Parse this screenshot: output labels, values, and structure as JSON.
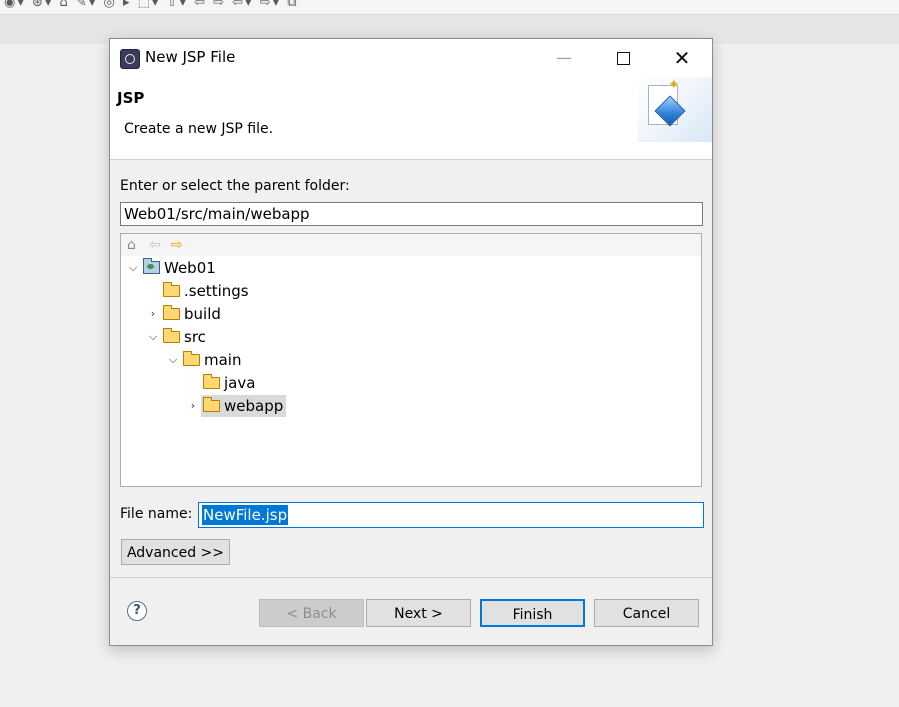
{
  "dialog": {
    "title": "New JSP File",
    "header_title": "JSP",
    "header_description": "Create a new JSP file.",
    "parent_folder_label": "Enter or select the parent folder:",
    "parent_folder_value": "Web01/src/main/webapp",
    "file_name_label": "File name:",
    "file_name_value": "NewFile.jsp",
    "advanced_label": "Advanced >>",
    "buttons": {
      "back": "< Back",
      "next": "Next >",
      "finish": "Finish",
      "cancel": "Cancel"
    },
    "help_glyph": "?"
  },
  "tree": {
    "items": [
      {
        "label": "Web01",
        "icon": "project-icon",
        "expanded": true
      },
      {
        "label": ".settings",
        "icon": "folder-icon"
      },
      {
        "label": "build",
        "icon": "folder-icon",
        "expanded": false
      },
      {
        "label": "src",
        "icon": "folder-icon",
        "expanded": true
      },
      {
        "label": "main",
        "icon": "folder-icon",
        "expanded": true
      },
      {
        "label": "java",
        "icon": "folder-icon"
      },
      {
        "label": "webapp",
        "icon": "folder-icon",
        "expanded": false,
        "selected": true
      }
    ]
  },
  "icons": {
    "window_minimize": "minimize-icon",
    "window_maximize": "maximize-icon",
    "window_close": "close-icon",
    "tree_home": "home-icon",
    "tree_back": "back-arrow-icon",
    "tree_forward": "forward-arrow-icon"
  },
  "colors": {
    "accent": "#0078d7",
    "selection_bg": "#d9d9d9",
    "folder": "#ffd873"
  }
}
